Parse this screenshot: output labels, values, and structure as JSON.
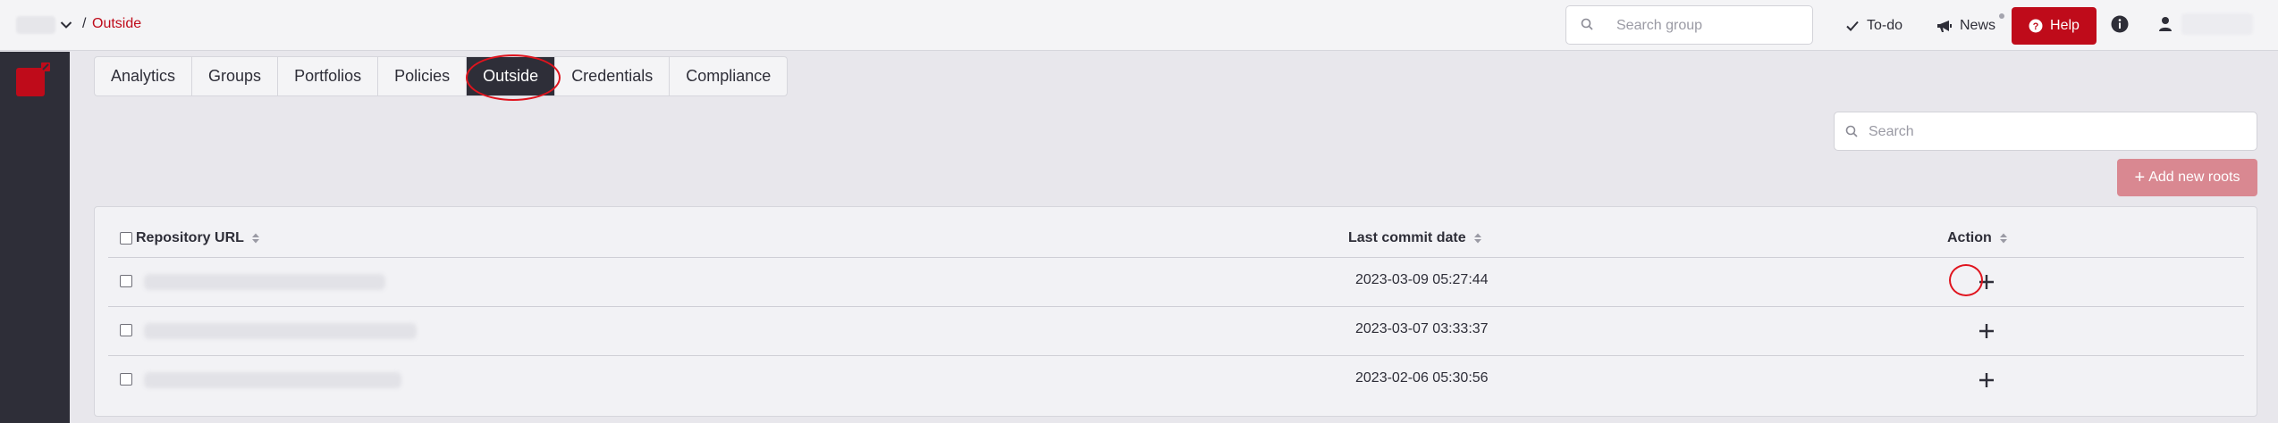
{
  "breadcrumb": {
    "separator": "/",
    "current": "Outside"
  },
  "header": {
    "search_placeholder": "Search group",
    "todo_label": "To-do",
    "news_label": "News",
    "help_label": "Help",
    "icons": [
      "chevron-down-icon",
      "search-icon",
      "check-icon",
      "megaphone-icon",
      "question-circle-icon",
      "info-icon",
      "user-icon"
    ]
  },
  "tabs": [
    {
      "label": "Analytics",
      "active": false
    },
    {
      "label": "Groups",
      "active": false
    },
    {
      "label": "Portfolios",
      "active": false
    },
    {
      "label": "Policies",
      "active": false
    },
    {
      "label": "Outside",
      "active": true
    },
    {
      "label": "Credentials",
      "active": false
    },
    {
      "label": "Compliance",
      "active": false
    }
  ],
  "content": {
    "search_placeholder": "Search",
    "add_button_label": "Add new roots"
  },
  "table": {
    "columns": [
      "Repository URL",
      "Last commit date",
      "Action"
    ],
    "rows": [
      {
        "last_commit_date": "2023-03-09 05:27:44",
        "action_icon": "plus-icon"
      },
      {
        "last_commit_date": "2023-03-07 03:33:37",
        "action_icon": "plus-icon"
      },
      {
        "last_commit_date": "2023-02-06 05:30:56",
        "action_icon": "plus-icon"
      }
    ]
  },
  "colors": {
    "brand_red": "#bf0b1a",
    "sidebar_dark": "#2e2e38",
    "add_button": "#d98891",
    "annotation_red": "#e0141e"
  }
}
